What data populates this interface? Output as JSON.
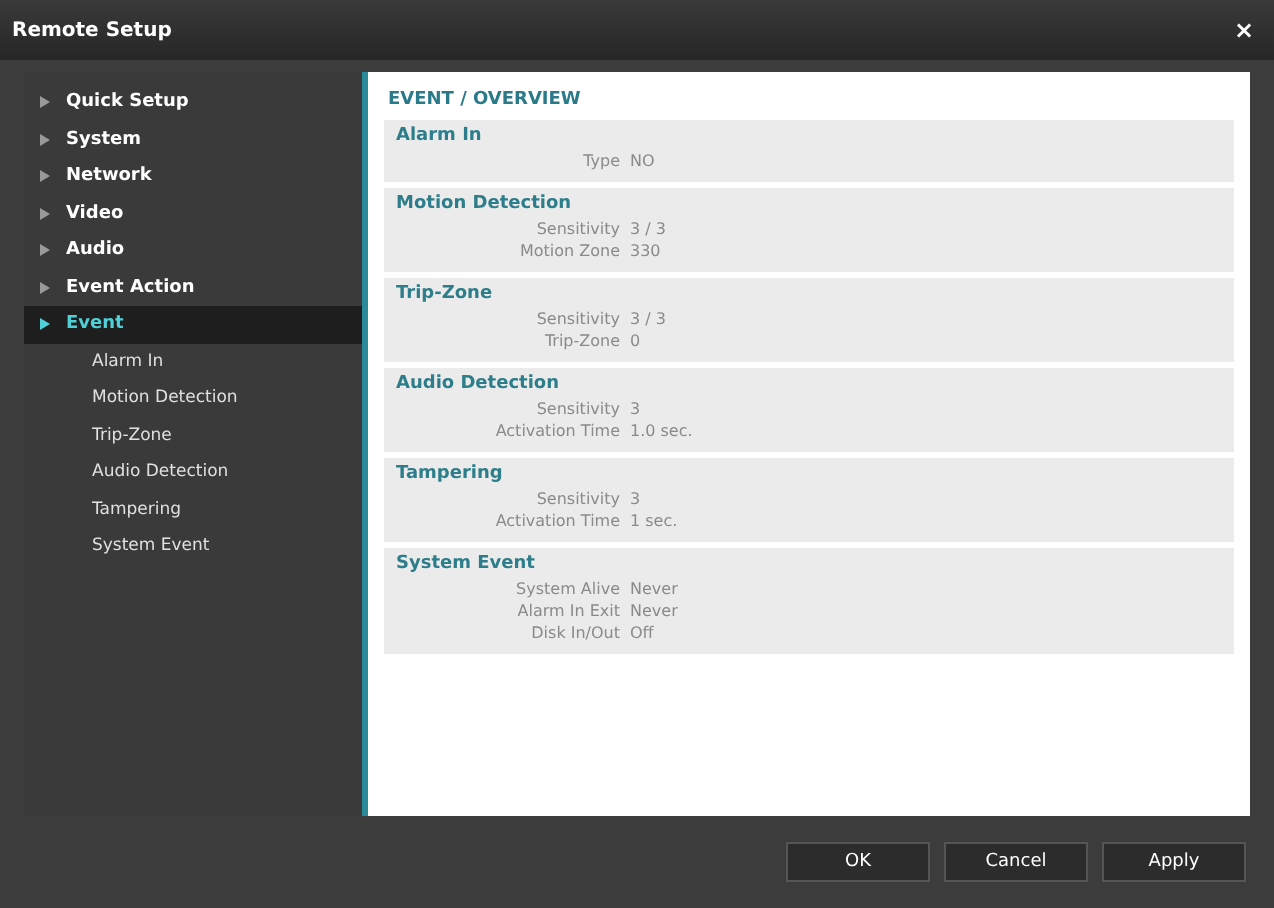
{
  "window": {
    "title": "Remote Setup",
    "close": "×"
  },
  "sidebar": {
    "items": [
      {
        "label": "Quick Setup",
        "selected": false
      },
      {
        "label": "System",
        "selected": false
      },
      {
        "label": "Network",
        "selected": false
      },
      {
        "label": "Video",
        "selected": false
      },
      {
        "label": "Audio",
        "selected": false
      },
      {
        "label": "Event Action",
        "selected": false
      },
      {
        "label": "Event",
        "selected": true,
        "children": [
          {
            "label": "Alarm In"
          },
          {
            "label": "Motion Detection"
          },
          {
            "label": "Trip-Zone"
          },
          {
            "label": "Audio Detection"
          },
          {
            "label": "Tampering"
          },
          {
            "label": "System Event"
          }
        ]
      }
    ]
  },
  "content": {
    "heading": "EVENT / OVERVIEW",
    "sections": [
      {
        "title": "Alarm In",
        "fields": [
          {
            "label": "Type",
            "value": "NO"
          }
        ]
      },
      {
        "title": "Motion Detection",
        "fields": [
          {
            "label": "Sensitivity",
            "value": "3 / 3"
          },
          {
            "label": "Motion Zone",
            "value": "330"
          }
        ]
      },
      {
        "title": "Trip-Zone",
        "fields": [
          {
            "label": "Sensitivity",
            "value": "3 / 3"
          },
          {
            "label": "Trip-Zone",
            "value": "0"
          }
        ]
      },
      {
        "title": "Audio Detection",
        "fields": [
          {
            "label": "Sensitivity",
            "value": "3"
          },
          {
            "label": "Activation Time",
            "value": "1.0 sec."
          }
        ]
      },
      {
        "title": "Tampering",
        "fields": [
          {
            "label": "Sensitivity",
            "value": "3"
          },
          {
            "label": "Activation Time",
            "value": "1 sec."
          }
        ]
      },
      {
        "title": "System Event",
        "fields": [
          {
            "label": "System Alive",
            "value": "Never"
          },
          {
            "label": "Alarm In Exit",
            "value": "Never"
          },
          {
            "label": "Disk In/Out",
            "value": "Off"
          }
        ]
      }
    ]
  },
  "buttons": [
    "OK",
    "Cancel",
    "Apply"
  ]
}
